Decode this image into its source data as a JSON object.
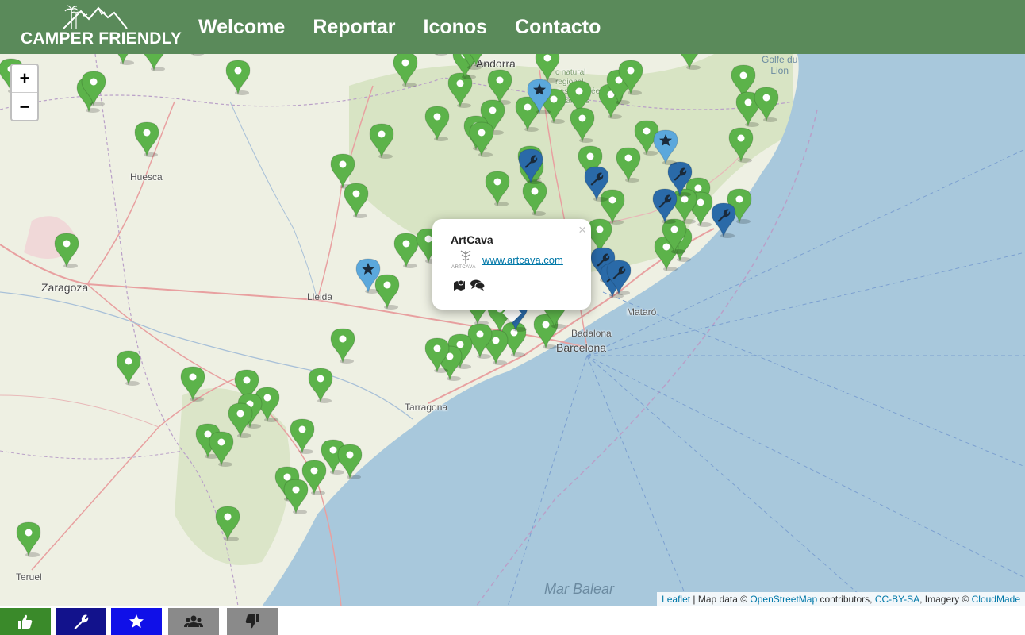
{
  "header": {
    "logo_text": "CAMPER FRIENDLY",
    "nav": [
      {
        "label": "Welcome"
      },
      {
        "label": "Reportar"
      },
      {
        "label": "Iconos"
      },
      {
        "label": "Contacto"
      }
    ]
  },
  "map": {
    "zoom_in": "+",
    "zoom_out": "−",
    "places": {
      "huesca": "Huesca",
      "zaragoza": "Zaragoza",
      "lleida": "Lleida",
      "tarragona": "Tarragona",
      "barcelona": "Barcelona",
      "badalona": "Badalona",
      "mataro": "Mataró",
      "teruel": "Teruel",
      "andorra": "Andorra",
      "mar_balear": "Mar Balear",
      "golfe_line1": "Golfe du",
      "golfe_line2": "Lion",
      "pyrenees_line1": "c natural",
      "pyrenees_line2": "regional",
      "pyrenees_line3": "des Pyrénées",
      "pyrenees_line4": "catalanes"
    },
    "marker_colors": {
      "green": "#5cb34a",
      "dark_blue": "#2a6aa8",
      "light_blue": "#5ba8dc"
    }
  },
  "popup": {
    "title": "ArtCava",
    "link": "www.artcava.com",
    "close": "×",
    "logo_caption": "ARTCAVA"
  },
  "attribution": {
    "leaflet": "Leaflet",
    "sep1": " | Map data © ",
    "osm": "OpenStreetMap",
    "contrib": " contributors, ",
    "license": "CC-BY-SA",
    "imagery": ", Imagery © ",
    "cloudmade": "CloudMade"
  },
  "filters": [
    {
      "name": "thumbs-up",
      "color": "#3a8a2a"
    },
    {
      "name": "wrench",
      "color": "#12128c"
    },
    {
      "name": "star",
      "color": "#1010e8"
    },
    {
      "name": "users",
      "color": "#8a8a8a"
    },
    {
      "name": "thumbs-down",
      "color": "#8a8a8a"
    }
  ]
}
